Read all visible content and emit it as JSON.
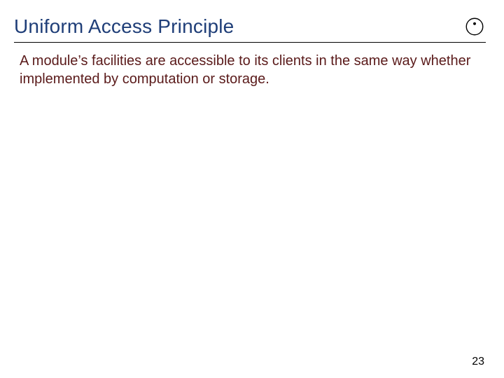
{
  "header": {
    "title": "Uniform Access Principle",
    "logo_name": "circle-dot-logo"
  },
  "body": {
    "text": "A module’s facilities are accessible to its clients in the same way whether implemented by computation or storage."
  },
  "footer": {
    "page_number": "23"
  },
  "colors": {
    "title": "#1f3e78",
    "body": "#5a1a1a",
    "rule": "#000000"
  }
}
